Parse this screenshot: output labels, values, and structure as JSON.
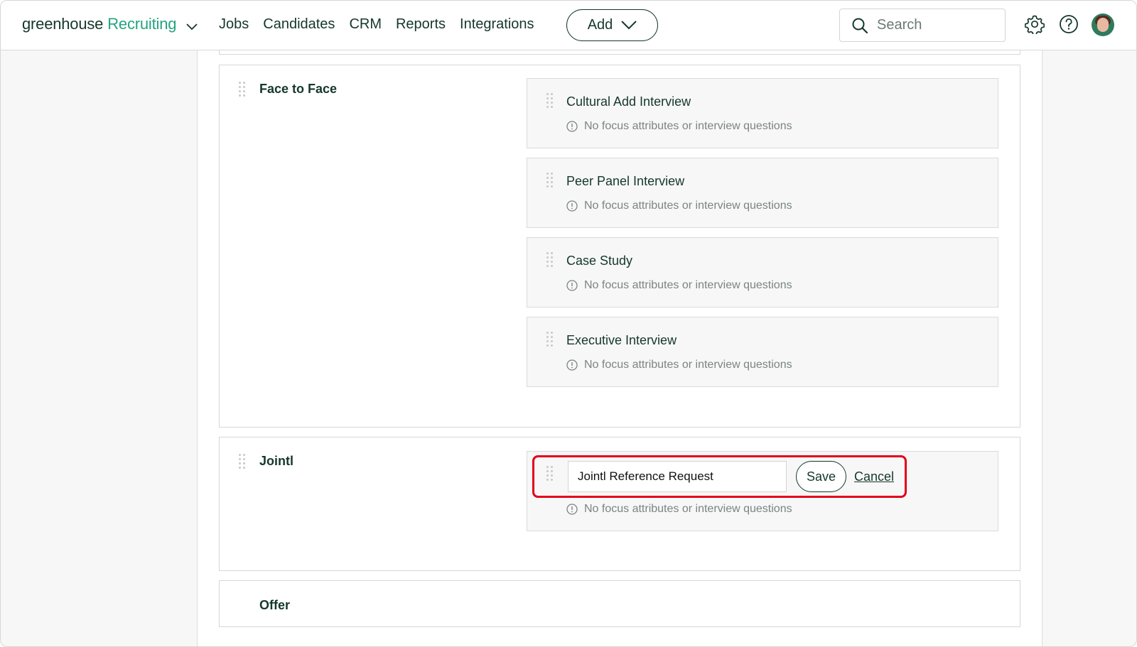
{
  "nav": {
    "brand_main": "greenhouse",
    "brand_accent": "Recruiting",
    "links": [
      "Jobs",
      "Candidates",
      "CRM",
      "Reports",
      "Integrations"
    ],
    "add_label": "Add",
    "search_placeholder": "Search"
  },
  "stages": [
    {
      "title": "Face to Face",
      "interviews": [
        {
          "title": "Cultural Add Interview",
          "note": "No focus attributes or interview questions"
        },
        {
          "title": "Peer Panel Interview",
          "note": "No focus attributes or interview questions"
        },
        {
          "title": "Case Study",
          "note": "No focus attributes or interview questions"
        },
        {
          "title": "Executive Interview",
          "note": "No focus attributes or interview questions"
        }
      ]
    },
    {
      "title": "Jointl",
      "editing": {
        "input_value": "Jointl Reference Request",
        "save_label": "Save",
        "cancel_label": "Cancel",
        "note": "No focus attributes or interview questions"
      }
    },
    {
      "title": "Offer"
    }
  ],
  "colors": {
    "brand_dark": "#15372c",
    "brand_accent": "#24a47f",
    "highlight": "#e3001b"
  }
}
